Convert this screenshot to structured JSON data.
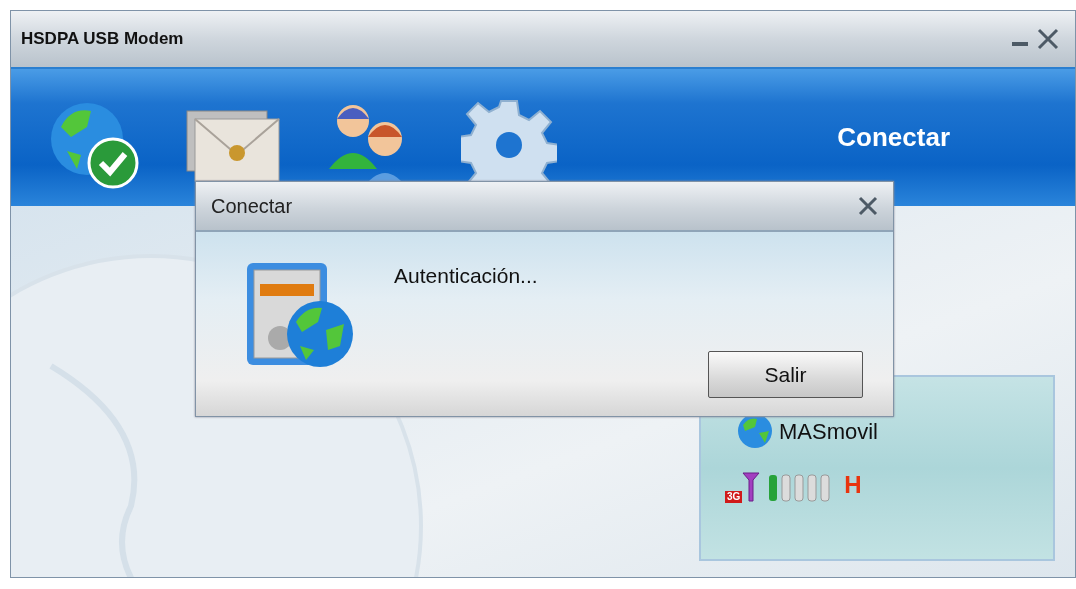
{
  "window": {
    "title": "HSDPA USB Modem"
  },
  "toolbar": {
    "status": "Conectar"
  },
  "dialog": {
    "title": "Conectar",
    "message": "Autenticación...",
    "buttons": [
      "Salir"
    ]
  },
  "network_panel": {
    "operator": "MASmovil",
    "network_badge": "3G",
    "network_type": "H"
  }
}
